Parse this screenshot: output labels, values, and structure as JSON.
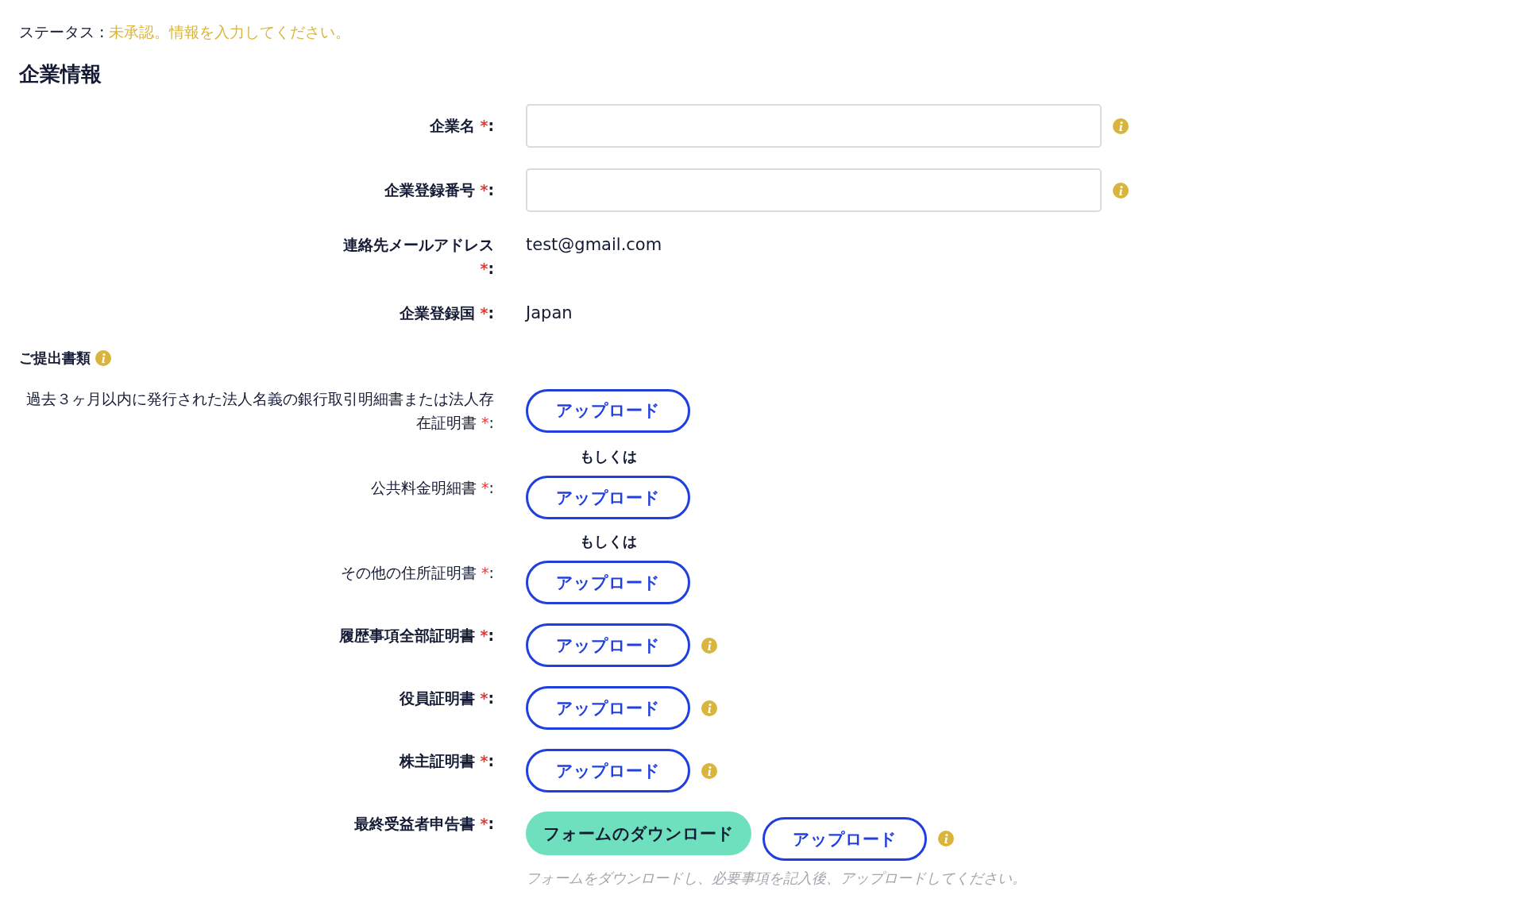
{
  "status": {
    "label": "ステータス :",
    "value": "未承認。情報を入力してください。"
  },
  "heading": "企業情報",
  "fields": [
    {
      "label": "企業名",
      "required_mark": "*",
      "colon": ":",
      "kind": "input",
      "info": true
    },
    {
      "label": "企業登録番号",
      "required_mark": "*",
      "colon": ":",
      "kind": "input",
      "info": true
    },
    {
      "label": "連絡先メールアドレス",
      "required_mark": "*",
      "colon": ":",
      "kind": "text",
      "value": "test@gmail.com",
      "info": false
    },
    {
      "label": "企業登録国",
      "required_mark": "*",
      "colon": ":",
      "kind": "text",
      "value": "Japan",
      "info": false
    }
  ],
  "documents": {
    "title": "ご提出書類",
    "info": true,
    "items": [
      {
        "kind": "upload",
        "label": "過去３ヶ月以内に発行された法人名義の銀行取引明細書または法人存在証明書",
        "bold": false,
        "required_mark": "*",
        "colon": ":",
        "upload_button": "アップロード",
        "info": false
      },
      {
        "kind": "or",
        "text": "もしくは"
      },
      {
        "kind": "upload",
        "label": "公共料金明細書",
        "bold": false,
        "required_mark": "*",
        "colon": ":",
        "upload_button": "アップロード",
        "info": false
      },
      {
        "kind": "or",
        "text": "もしくは"
      },
      {
        "kind": "upload",
        "label": "その他の住所証明書",
        "bold": false,
        "required_mark": "*",
        "colon": ":",
        "upload_button": "アップロード",
        "info": false
      },
      {
        "kind": "upload",
        "label": "履歴事項全部証明書",
        "bold": true,
        "required_mark": "*",
        "colon": ":",
        "upload_button": "アップロード",
        "info": true
      },
      {
        "kind": "upload",
        "label": "役員証明書",
        "bold": true,
        "required_mark": "*",
        "colon": ":",
        "upload_button": "アップロード",
        "info": true
      },
      {
        "kind": "upload",
        "label": "株主証明書",
        "bold": true,
        "required_mark": "*",
        "colon": ":",
        "upload_button": "アップロード",
        "info": true
      },
      {
        "kind": "download_upload",
        "label": "最終受益者申告書",
        "bold": true,
        "required_mark": "*",
        "colon": ":",
        "download_button": "フォームのダウンロード",
        "upload_button": "アップロード",
        "info": true,
        "note": "フォームをダウンロードし、必要事項を記入後、アップロードしてください。"
      }
    ]
  }
}
